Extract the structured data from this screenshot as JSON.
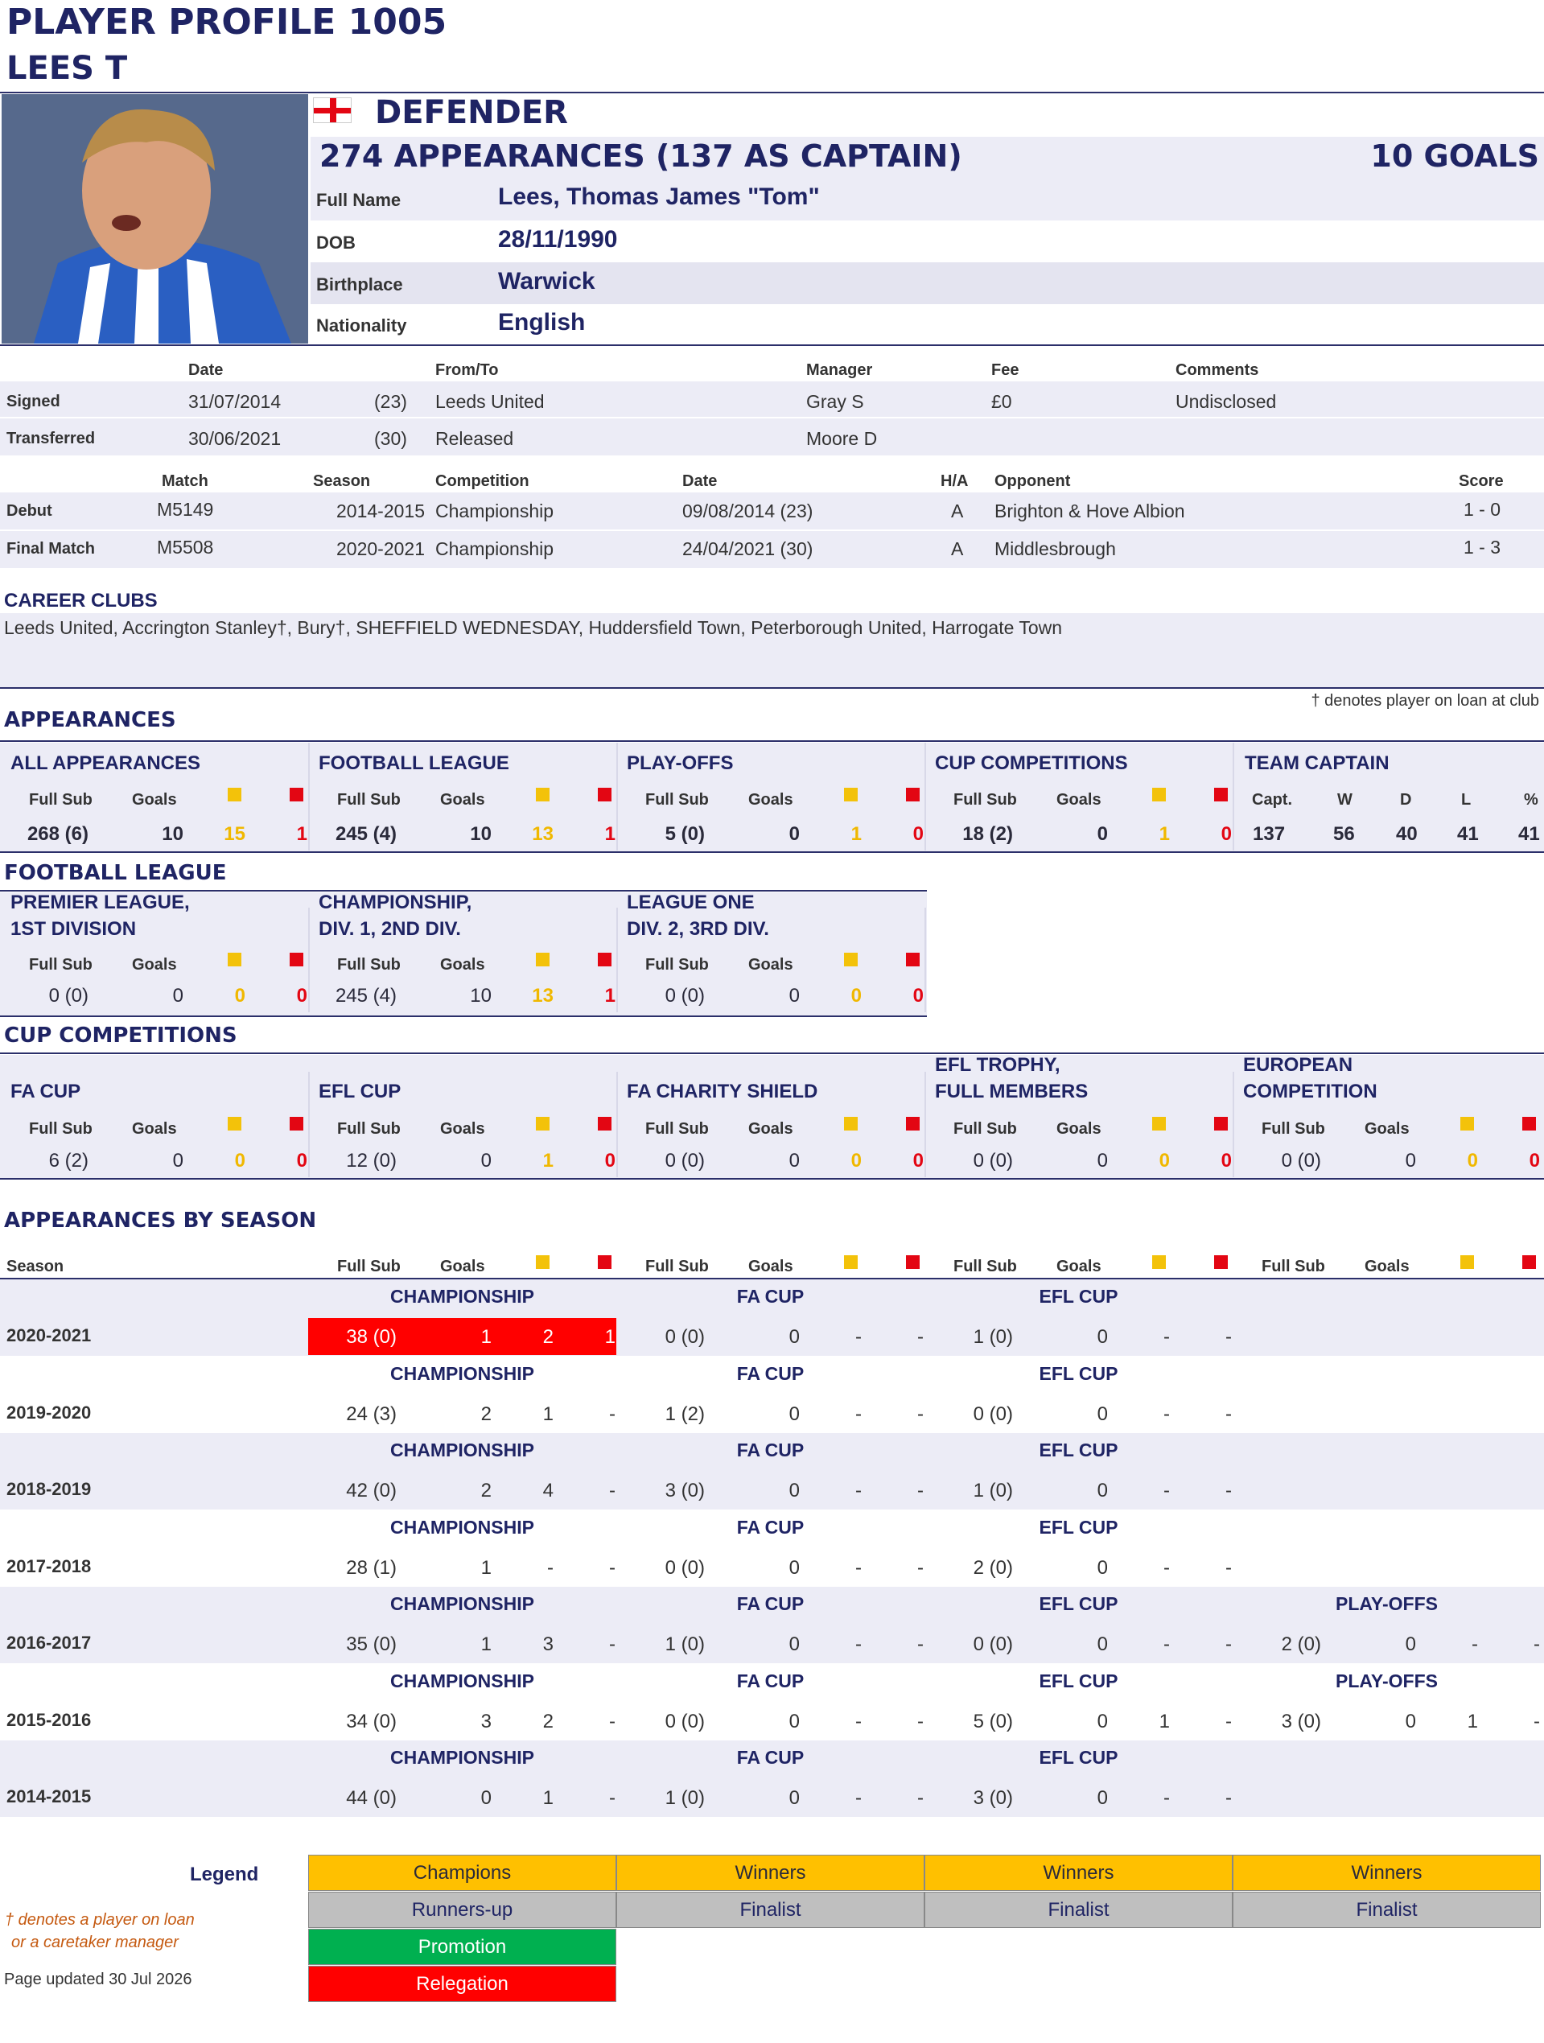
{
  "header": {
    "title": "PLAYER PROFILE 1005",
    "name": "LEES T"
  },
  "profile": {
    "position": "DEFENDER",
    "appearances": "274 APPEARANCES (137 AS CAPTAIN)",
    "goals": "10 GOALS",
    "fields": [
      {
        "label": "Full Name",
        "value": "Lees, Thomas James \"Tom\""
      },
      {
        "label": "DOB",
        "value": "28/11/1990"
      },
      {
        "label": "Birthplace",
        "value": "Warwick"
      },
      {
        "label": "Nationality",
        "value": "English"
      }
    ]
  },
  "transfers": {
    "headers": {
      "date": "Date",
      "from_to": "From/To",
      "manager": "Manager",
      "fee": "Fee",
      "comments": "Comments"
    },
    "rows": [
      {
        "label": "Signed",
        "date": "31/07/2014",
        "age": "(23)",
        "club": "Leeds United",
        "manager": "Gray S",
        "fee": "£0",
        "comments": "Undisclosed"
      },
      {
        "label": "Transferred",
        "date": "30/06/2021",
        "age": "(30)",
        "club": "Released",
        "manager": "Moore D",
        "fee": "",
        "comments": ""
      }
    ]
  },
  "matches": {
    "headers": {
      "match": "Match",
      "season": "Season",
      "competition": "Competition",
      "date": "Date",
      "ha": "H/A",
      "opponent": "Opponent",
      "score": "Score"
    },
    "rows": [
      {
        "label": "Debut",
        "match": "M5149",
        "season": "2014-2015",
        "competition": "Championship",
        "date": "09/08/2014 (23)",
        "ha": "A",
        "opponent": "Brighton & Hove Albion",
        "score": "1 - 0"
      },
      {
        "label": "Final Match",
        "match": "M5508",
        "season": "2020-2021",
        "competition": "Championship",
        "date": "24/04/2021 (30)",
        "ha": "A",
        "opponent": "Middlesbrough",
        "score": "1 - 3"
      }
    ]
  },
  "career": {
    "heading": "CAREER CLUBS",
    "clubs": "Leeds United, Accrington Stanley†, Bury†, SHEFFIELD WEDNESDAY, Huddersfield Town, Peterborough United, Harrogate Town",
    "loan_note": "† denotes player on loan at club"
  },
  "stat_labels": {
    "full_sub": "Full Sub",
    "goals": "Goals",
    "capt": "Capt.",
    "w": "W",
    "d": "D",
    "l": "L",
    "pct": "%",
    "season": "Season"
  },
  "appearances": {
    "heading": "APPEARANCES",
    "blocks": [
      {
        "title": "ALL APPEARANCES",
        "full_sub": "268 (6)",
        "goals": "10",
        "yellow": "15",
        "red": "1"
      },
      {
        "title": "FOOTBALL LEAGUE",
        "full_sub": "245 (4)",
        "goals": "10",
        "yellow": "13",
        "red": "1"
      },
      {
        "title": "PLAY-OFFS",
        "full_sub": "5 (0)",
        "goals": "0",
        "yellow": "1",
        "red": "0"
      },
      {
        "title": "CUP COMPETITIONS",
        "full_sub": "18 (2)",
        "goals": "0",
        "yellow": "1",
        "red": "0"
      }
    ],
    "captain": {
      "title": "TEAM CAPTAIN",
      "capt": "137",
      "w": "56",
      "d": "40",
      "l": "41",
      "pct": "41"
    }
  },
  "league": {
    "heading": "FOOTBALL LEAGUE",
    "blocks": [
      {
        "title1": "PREMIER LEAGUE,",
        "title2": "1ST DIVISION",
        "full_sub": "0 (0)",
        "goals": "0",
        "yellow": "0",
        "red": "0"
      },
      {
        "title1": "CHAMPIONSHIP,",
        "title2": "DIV. 1, 2ND DIV.",
        "full_sub": "245 (4)",
        "goals": "10",
        "yellow": "13",
        "red": "1"
      },
      {
        "title1": "LEAGUE ONE",
        "title2": "DIV. 2, 3RD DIV.",
        "full_sub": "0 (0)",
        "goals": "0",
        "yellow": "0",
        "red": "0"
      }
    ]
  },
  "cups": {
    "heading": "CUP COMPETITIONS",
    "blocks": [
      {
        "title1": "",
        "title2": "FA CUP",
        "full_sub": "6 (2)",
        "goals": "0",
        "yellow": "0",
        "red": "0"
      },
      {
        "title1": "",
        "title2": "EFL CUP",
        "full_sub": "12 (0)",
        "goals": "0",
        "yellow": "1",
        "red": "0"
      },
      {
        "title1": "",
        "title2": "FA CHARITY SHIELD",
        "full_sub": "0 (0)",
        "goals": "0",
        "yellow": "0",
        "red": "0"
      },
      {
        "title1": "EFL TROPHY,",
        "title2": "FULL MEMBERS",
        "full_sub": "0 (0)",
        "goals": "0",
        "yellow": "0",
        "red": "0"
      },
      {
        "title1": "EUROPEAN",
        "title2": "COMPETITION",
        "full_sub": "0 (0)",
        "goals": "0",
        "yellow": "0",
        "red": "0"
      }
    ]
  },
  "by_season": {
    "heading": "APPEARANCES BY SEASON",
    "seasons": [
      {
        "season": "2020-2021",
        "comps": [
          {
            "name": "CHAMPIONSHIP",
            "full_sub": "38 (0)",
            "goals": "1",
            "yellow": "2",
            "red": "1",
            "highlight": "relegation"
          },
          {
            "name": "FA CUP",
            "full_sub": "0 (0)",
            "goals": "0",
            "yellow": "-",
            "red": "-"
          },
          {
            "name": "EFL CUP",
            "full_sub": "1 (0)",
            "goals": "0",
            "yellow": "-",
            "red": "-"
          }
        ]
      },
      {
        "season": "2019-2020",
        "comps": [
          {
            "name": "CHAMPIONSHIP",
            "full_sub": "24 (3)",
            "goals": "2",
            "yellow": "1",
            "red": "-"
          },
          {
            "name": "FA CUP",
            "full_sub": "1 (2)",
            "goals": "0",
            "yellow": "-",
            "red": "-"
          },
          {
            "name": "EFL CUP",
            "full_sub": "0 (0)",
            "goals": "0",
            "yellow": "-",
            "red": "-"
          }
        ]
      },
      {
        "season": "2018-2019",
        "comps": [
          {
            "name": "CHAMPIONSHIP",
            "full_sub": "42 (0)",
            "goals": "2",
            "yellow": "4",
            "red": "-"
          },
          {
            "name": "FA CUP",
            "full_sub": "3 (0)",
            "goals": "0",
            "yellow": "-",
            "red": "-"
          },
          {
            "name": "EFL CUP",
            "full_sub": "1 (0)",
            "goals": "0",
            "yellow": "-",
            "red": "-"
          }
        ]
      },
      {
        "season": "2017-2018",
        "comps": [
          {
            "name": "CHAMPIONSHIP",
            "full_sub": "28 (1)",
            "goals": "1",
            "yellow": "-",
            "red": "-"
          },
          {
            "name": "FA CUP",
            "full_sub": "0 (0)",
            "goals": "0",
            "yellow": "-",
            "red": "-"
          },
          {
            "name": "EFL CUP",
            "full_sub": "2 (0)",
            "goals": "0",
            "yellow": "-",
            "red": "-"
          }
        ]
      },
      {
        "season": "2016-2017",
        "comps": [
          {
            "name": "CHAMPIONSHIP",
            "full_sub": "35 (0)",
            "goals": "1",
            "yellow": "3",
            "red": "-"
          },
          {
            "name": "FA CUP",
            "full_sub": "1 (0)",
            "goals": "0",
            "yellow": "-",
            "red": "-"
          },
          {
            "name": "EFL CUP",
            "full_sub": "0 (0)",
            "goals": "0",
            "yellow": "-",
            "red": "-"
          },
          {
            "name": "PLAY-OFFS",
            "full_sub": "2 (0)",
            "goals": "0",
            "yellow": "-",
            "red": "-"
          }
        ]
      },
      {
        "season": "2015-2016",
        "comps": [
          {
            "name": "CHAMPIONSHIP",
            "full_sub": "34 (0)",
            "goals": "3",
            "yellow": "2",
            "red": "-"
          },
          {
            "name": "FA CUP",
            "full_sub": "0 (0)",
            "goals": "0",
            "yellow": "-",
            "red": "-"
          },
          {
            "name": "EFL CUP",
            "full_sub": "5 (0)",
            "goals": "0",
            "yellow": "1",
            "red": "-"
          },
          {
            "name": "PLAY-OFFS",
            "full_sub": "3 (0)",
            "goals": "0",
            "yellow": "1",
            "red": "-"
          }
        ]
      },
      {
        "season": "2014-2015",
        "comps": [
          {
            "name": "CHAMPIONSHIP",
            "full_sub": "44 (0)",
            "goals": "0",
            "yellow": "1",
            "red": "-"
          },
          {
            "name": "FA CUP",
            "full_sub": "1 (0)",
            "goals": "0",
            "yellow": "-",
            "red": "-"
          },
          {
            "name": "EFL CUP",
            "full_sub": "3 (0)",
            "goals": "0",
            "yellow": "-",
            "red": "-"
          }
        ]
      }
    ]
  },
  "legend": {
    "title": "Legend",
    "note1": "† denotes a player on loan",
    "note2": "or a caretaker manager",
    "updated": "Page updated 30 Jul 2026",
    "row1": [
      "Champions",
      "Winners",
      "Winners",
      "Winners"
    ],
    "row2": [
      "Runners-up",
      "Finalist",
      "Finalist",
      "Finalist"
    ],
    "promotion": "Promotion",
    "relegation": "Relegation"
  },
  "colors": {
    "navy": "#1f2464",
    "band": "#ececf6",
    "yellow_card": "#f3c20a",
    "red_card": "#e30613",
    "champions": "#ffc000",
    "runners_up": "#bfbfbf",
    "promotion": "#00b050",
    "relegation": "#ff0000"
  },
  "icons": {
    "flag": "england-flag-icon",
    "photo": "player-photo"
  }
}
